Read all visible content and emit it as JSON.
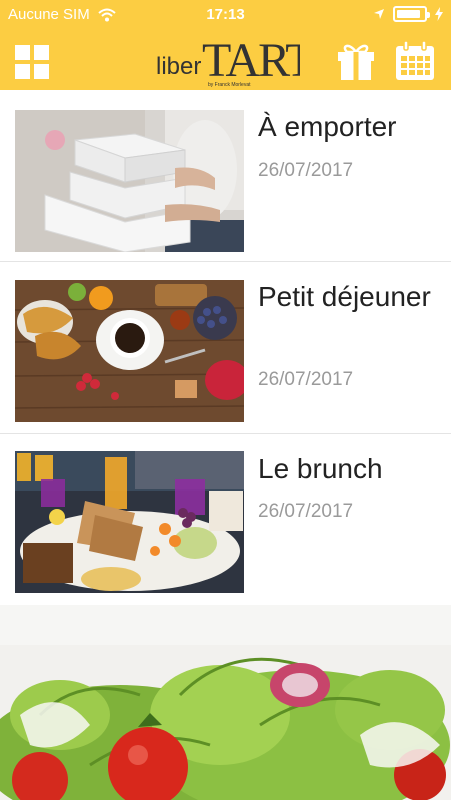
{
  "status_bar": {
    "carrier": "Aucune SIM",
    "time": "17:13",
    "battery_level": 0.9
  },
  "nav": {
    "logo_text_left": "liber",
    "logo_text_right": "TART",
    "logo_tagline": "by Franck Morlevat",
    "menu_icon": "grid-icon",
    "gift_icon": "gift-icon",
    "calendar_icon": "calendar-icon"
  },
  "colors": {
    "header": "#fccd42",
    "title_text": "#222222",
    "date_text": "#9a9a9a",
    "separator": "#e4e4e4"
  },
  "items": [
    {
      "title": "À emporter",
      "date": "26/07/2017",
      "image": "takeaway-boxes-photo"
    },
    {
      "title": "Petit déjeuner",
      "date": "26/07/2017",
      "image": "breakfast-table-photo"
    },
    {
      "title": "Le brunch",
      "date": "26/07/2017",
      "image": "brunch-table-photo"
    }
  ],
  "banner": {
    "image": "salad-photo"
  }
}
